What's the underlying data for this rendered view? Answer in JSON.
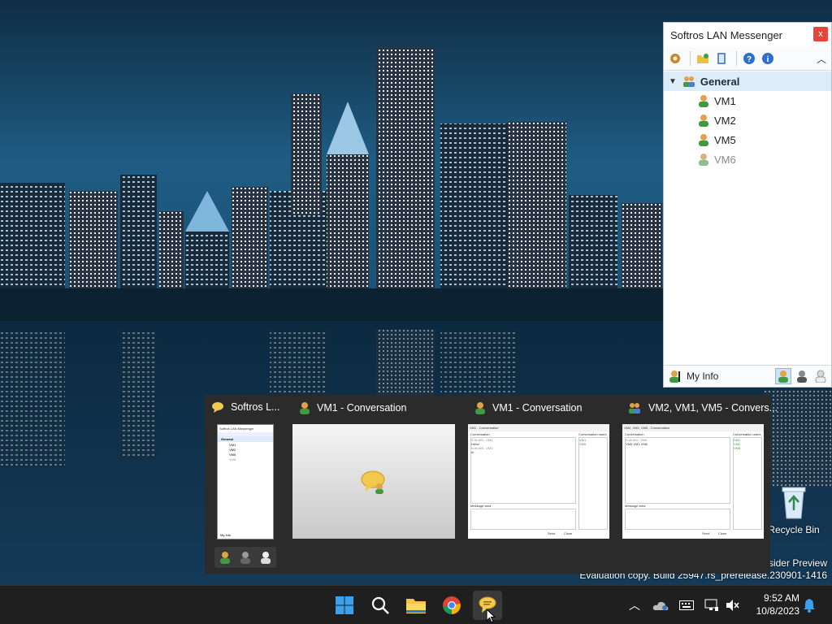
{
  "messenger": {
    "title": "Softros LAN Messenger",
    "close_label": "x",
    "group": "General",
    "members": [
      {
        "name": "VM1",
        "status": "online"
      },
      {
        "name": "VM2",
        "status": "online"
      },
      {
        "name": "VM5",
        "status": "online"
      },
      {
        "name": "VM6",
        "status": "offline"
      }
    ],
    "my_info_label": "My Info",
    "toolbar_icons": [
      "settings-icon",
      "open-folder-icon",
      "history-icon",
      "help-icon",
      "info-icon"
    ]
  },
  "thumbnails": [
    {
      "title": "Softros L...",
      "icon": "messenger-icon"
    },
    {
      "title": "VM1 - Conversation",
      "icon": "user-icon"
    },
    {
      "title": "VM1 - Conversation",
      "icon": "user-icon"
    },
    {
      "title": "VM2, VM1, VM5 - Convers...",
      "icon": "users-icon"
    }
  ],
  "mini_preview": {
    "title": "Softros LAN Messenger",
    "group": "General",
    "members": [
      "VM1",
      "VM2",
      "VM5",
      "VM6"
    ],
    "my_info": "My Info"
  },
  "conv_preview_1": {
    "header": "VM1 - Conversation",
    "section_label": "Conversation",
    "participants_label": "Conversation users",
    "lines": [
      "9:45 AM - VM1",
      "Hello!",
      "9:46 AM - VM1",
      "hi"
    ],
    "participants": [
      "VM1",
      "VM6"
    ],
    "message_label": "Message area",
    "buttons": [
      "Send",
      "Close"
    ]
  },
  "conv_preview_2": {
    "header": "VM2, VM1, VM5 - Conversation",
    "section_label": "Conversation",
    "participants_label": "Conversation users",
    "lines": [
      "9:48 AM - VM6",
      "VM5 VM1 VM6"
    ],
    "participants": [
      "VM1",
      "VM2",
      "VM5"
    ],
    "message_label": "Message area",
    "buttons": [
      "Send",
      "Close"
    ]
  },
  "desktop": {
    "recycle_bin_label": "Recycle Bin",
    "watermark_line1": "nsider Preview",
    "watermark_line2": "Evaluation copy. Build 25947.rs_prerelease.230901-1416"
  },
  "taskbar": {
    "apps": [
      "start-icon",
      "search-icon",
      "file-explorer-icon",
      "chrome-icon",
      "messenger-icon"
    ],
    "time": "9:52 AM",
    "date": "10/8/2023"
  },
  "colors": {
    "taskbar_bg": "#1f1f1f",
    "popup_bg": "#2b2b2b",
    "group_highlight": "#dcecf9",
    "close_red": "#e2483a"
  }
}
